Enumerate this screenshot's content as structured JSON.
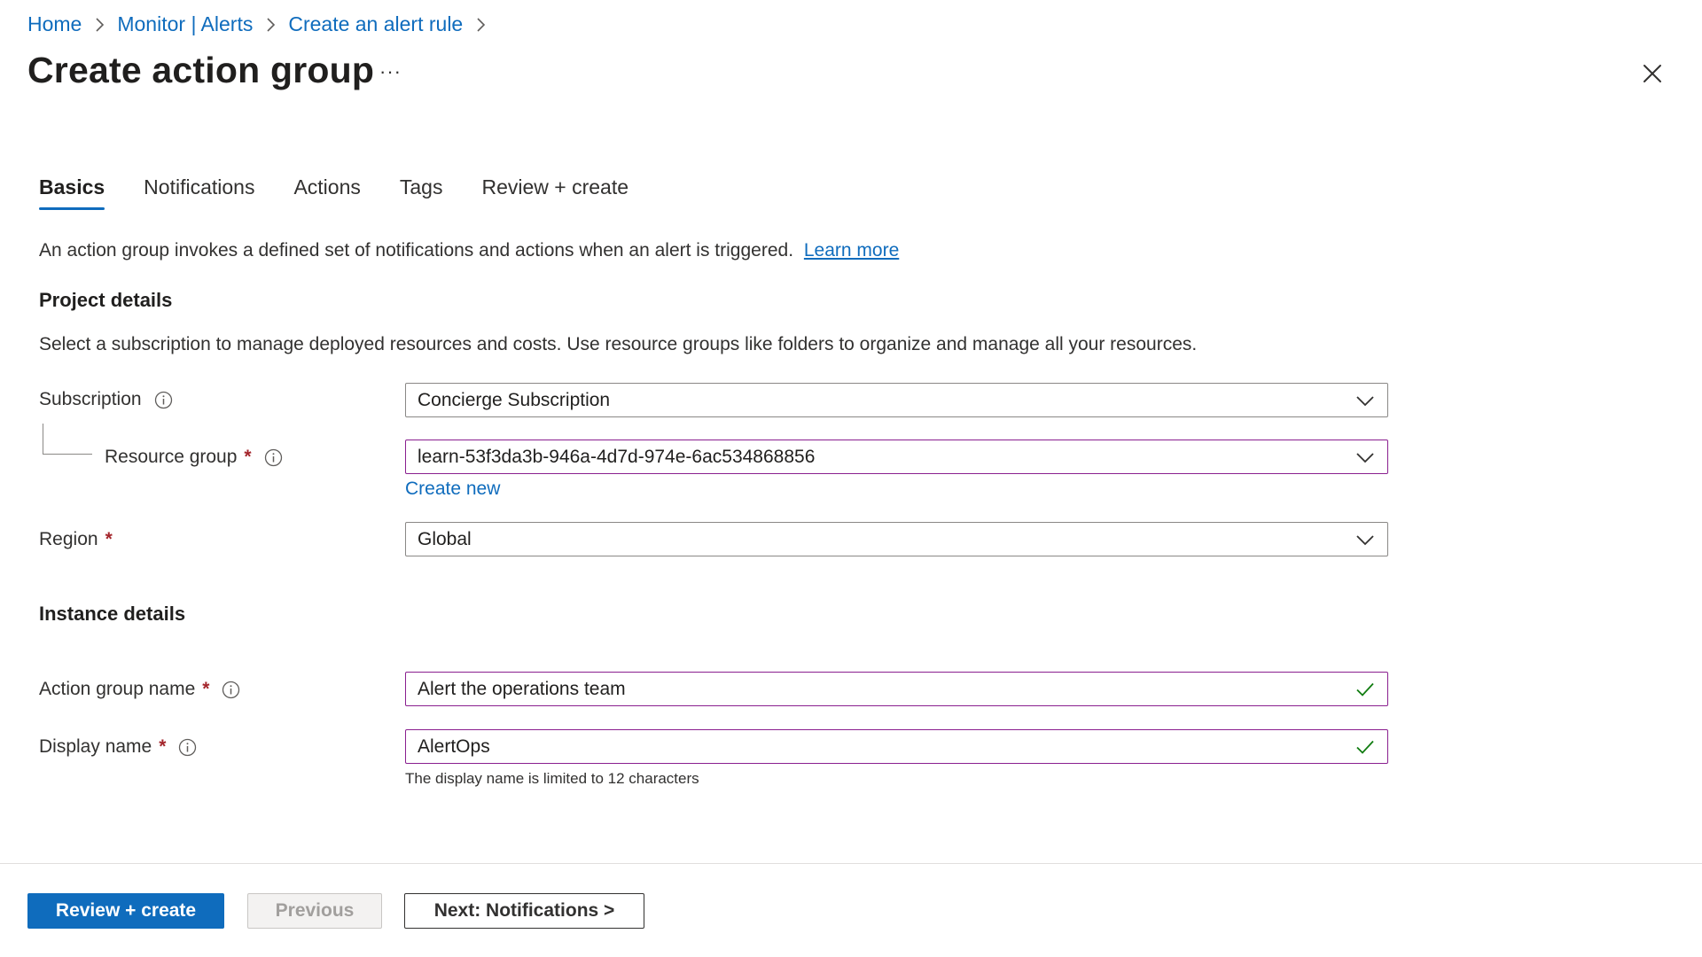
{
  "breadcrumb": {
    "items": [
      "Home",
      "Monitor | Alerts",
      "Create an alert rule"
    ]
  },
  "page": {
    "title": "Create action group",
    "more_label": "···"
  },
  "tabs": [
    {
      "label": "Basics",
      "active": true
    },
    {
      "label": "Notifications",
      "active": false
    },
    {
      "label": "Actions",
      "active": false
    },
    {
      "label": "Tags",
      "active": false
    },
    {
      "label": "Review + create",
      "active": false
    }
  ],
  "intro": {
    "text": "An action group invokes a defined set of notifications and actions when an alert is triggered.",
    "link": "Learn more"
  },
  "project": {
    "heading": "Project details",
    "description": "Select a subscription to manage deployed resources and costs. Use resource groups like folders to organize and manage all your resources.",
    "subscription": {
      "label": "Subscription",
      "value": "Concierge Subscription"
    },
    "resource_group": {
      "label": "Resource group",
      "value": "learn-53f3da3b-946a-4d7d-974e-6ac534868856",
      "create_new": "Create new"
    },
    "region": {
      "label": "Region",
      "value": "Global"
    }
  },
  "instance": {
    "heading": "Instance details",
    "action_group_name": {
      "label": "Action group name",
      "value": "Alert the operations team"
    },
    "display_name": {
      "label": "Display name",
      "value": "AlertOps",
      "hint": "The display name is limited to 12 characters"
    }
  },
  "required_marker": "*",
  "footer": {
    "review_create": "Review + create",
    "previous": "Previous",
    "next": "Next: Notifications >"
  },
  "colors": {
    "accent": "#0f6cbd",
    "focus_border": "#8a1f8f",
    "required": "#a4262c",
    "valid_check": "#107c10"
  }
}
